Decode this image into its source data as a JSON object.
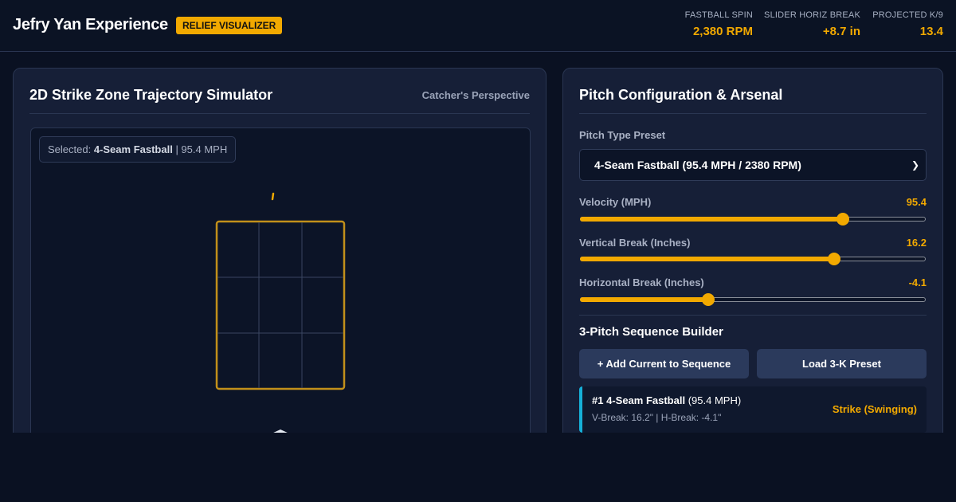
{
  "header": {
    "title": "Jefry Yan Experience",
    "badge": "RELIEF VISUALIZER",
    "stats": [
      {
        "label": "FASTBALL SPIN",
        "value": "2,380 RPM"
      },
      {
        "label": "SLIDER HORIZ BREAK",
        "value": "+8.7 in"
      },
      {
        "label": "PROJECTED K/9",
        "value": "13.4"
      }
    ]
  },
  "simulator": {
    "title": "2D Strike Zone Trajectory Simulator",
    "perspective": "Catcher's Perspective",
    "selected_prefix": "Selected: ",
    "selected_pitch": "4-Seam Fastball",
    "selected_speed": " | 95.4 MPH"
  },
  "config": {
    "title": "Pitch Configuration & Arsenal",
    "preset_label": "Pitch Type Preset",
    "preset_value": "4-Seam Fastball (95.4 MPH / 2380 RPM)",
    "sliders": [
      {
        "label": "Velocity (MPH)",
        "value": "95.4",
        "fraction": 0.76
      },
      {
        "label": "Vertical Break (Inches)",
        "value": "16.2",
        "fraction": 0.735
      },
      {
        "label": "Horizontal Break (Inches)",
        "value": "-4.1",
        "fraction": 0.37
      }
    ]
  },
  "sequence": {
    "title": "3-Pitch Sequence Builder",
    "add_button": "+ Add Current to Sequence",
    "preset_button": "Load 3-K Preset",
    "items": [
      {
        "index": "#1",
        "pitch": "4-Seam Fastball",
        "speed": "(95.4 MPH)",
        "breaks": "V-Break: 16.2\" | H-Break: -4.1\"",
        "result": "Strike (Swinging)"
      }
    ]
  },
  "colors": {
    "accent": "#f2a900",
    "background": "#0a1122",
    "card": "#161f37",
    "sequence_marker": "#16b0d8"
  }
}
